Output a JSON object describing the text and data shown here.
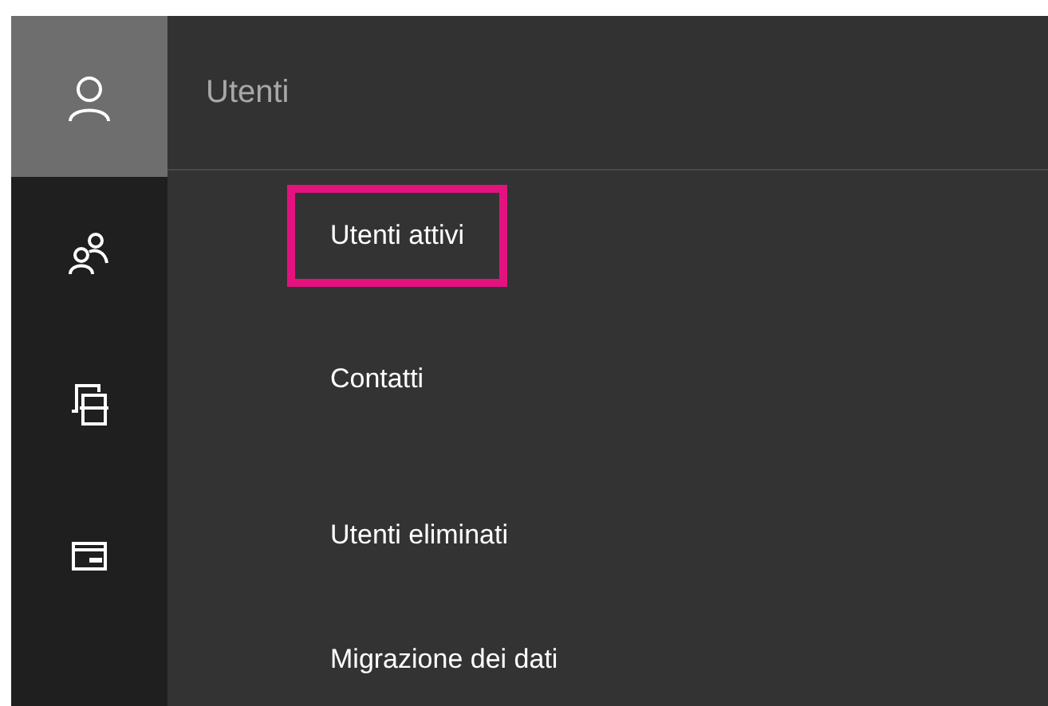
{
  "header": {
    "title": "Utenti"
  },
  "rail": [
    {
      "kind": "user",
      "selected": true
    },
    {
      "kind": "group",
      "selected": false
    },
    {
      "kind": "contacts",
      "selected": false
    },
    {
      "kind": "card",
      "selected": false
    }
  ],
  "menu": [
    {
      "label": "Utenti attivi",
      "highlighted": true
    },
    {
      "label": "Contatti",
      "highlighted": false
    },
    {
      "label": "Utenti eliminati",
      "highlighted": false
    },
    {
      "label": "Migrazione dei dati",
      "highlighted": false
    }
  ]
}
